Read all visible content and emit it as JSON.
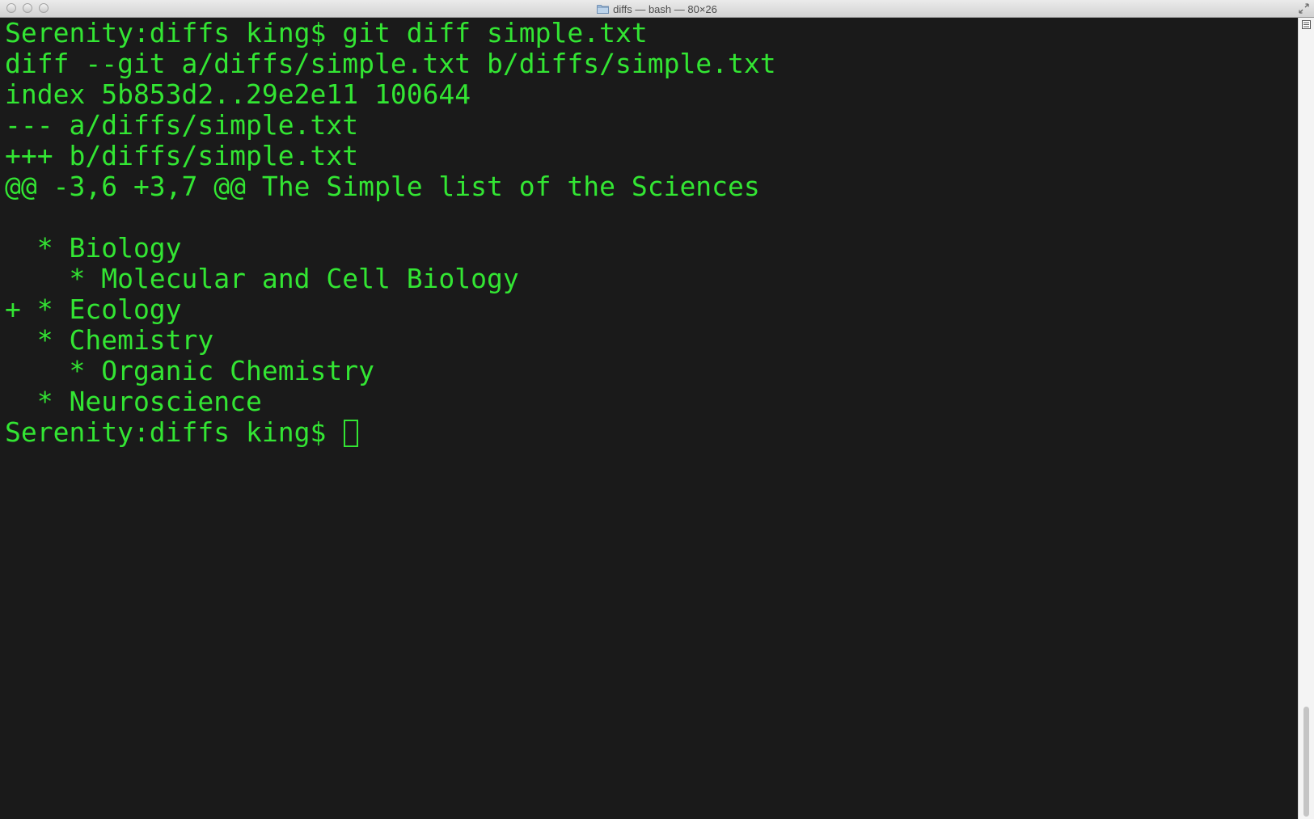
{
  "window": {
    "title": "diffs — bash — 80×26",
    "folder_icon": "folder-icon",
    "fullscreen_icon": "fullscreen-arrows-icon",
    "split_icon": "split-pane-icon"
  },
  "colors": {
    "background": "#1a1a1a",
    "text": "#33e533"
  },
  "terminal": {
    "lines": [
      "Serenity:diffs king$ git diff simple.txt",
      "diff --git a/diffs/simple.txt b/diffs/simple.txt",
      "index 5b853d2..29e2e11 100644",
      "--- a/diffs/simple.txt",
      "+++ b/diffs/simple.txt",
      "@@ -3,6 +3,7 @@ The Simple list of the Sciences",
      "",
      "  * Biology",
      "    * Molecular and Cell Biology",
      "+ * Ecology",
      "  * Chemistry",
      "    * Organic Chemistry",
      "  * Neuroscience"
    ],
    "prompt": "Serenity:diffs king$ "
  }
}
